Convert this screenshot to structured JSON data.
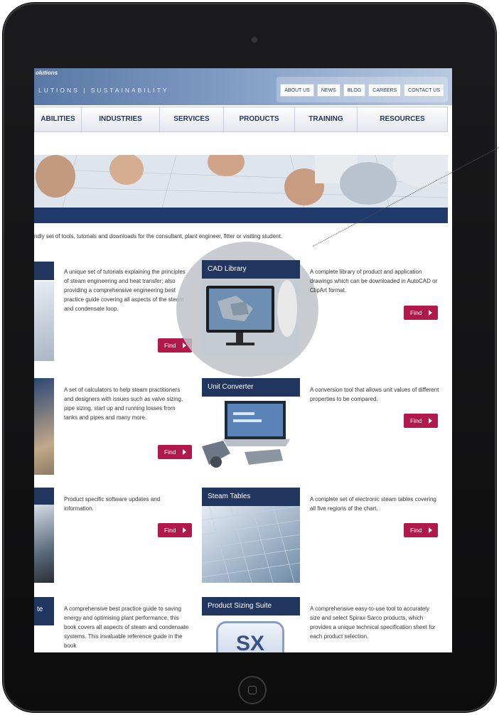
{
  "header": {
    "brand_small": "olutions",
    "tagline": "LUTIONS | SUSTAINABILITY",
    "top_links": [
      "ABOUT US",
      "NEWS",
      "BLOG",
      "CAREERS",
      "CONTACT US"
    ]
  },
  "nav": {
    "items": [
      "ABILITIES",
      "INDUSTRIES",
      "SERVICES",
      "PRODUCTS",
      "TRAINING",
      "RESOURCES"
    ]
  },
  "intro_text": "ndly set of tools, tutorials and downloads for the consultant, plant engineer, fitter or visiting student.",
  "left_descriptions": [
    "A unique set of tutorials explaining the principles of steam engineering and heat transfer; also providing a comprehensive engineering best practice guide covering all aspects of the steam and condensate loop.",
    "A set of calculators to help steam practitioners and designers with issues such as valve sizing, pipe sizing, start up and running losses from tanks and pipes and many more.",
    "Product specific software updates and information.",
    "A comprehensive best practice guide to saving energy and optimising plant performance, this book covers all aspects of steam and condensate systems. This invaluable reference guide in the book"
  ],
  "left_row4_label": "te",
  "tools": [
    {
      "title": "CAD Library",
      "description": "A complete library of product and application drawings which can be downloaded in AutoCAD or ClipArt format."
    },
    {
      "title": "Unit Converter",
      "description": "A conversion tool that allows unit values of different properties to be compared."
    },
    {
      "title": "Steam Tables",
      "description": "A complete set of electronic steam tables covering all five regions of the chart."
    },
    {
      "title": "Product Sizing Suite",
      "description": "A comprehensive easy-to-use tool to accurately size and select Spirax-Sarco products, which provides a unique technical specification sheet for each product selection."
    }
  ],
  "find_label": "Find",
  "sx_logo": "SX",
  "colors": {
    "navy": "#20365f",
    "find": "#b0194a"
  }
}
